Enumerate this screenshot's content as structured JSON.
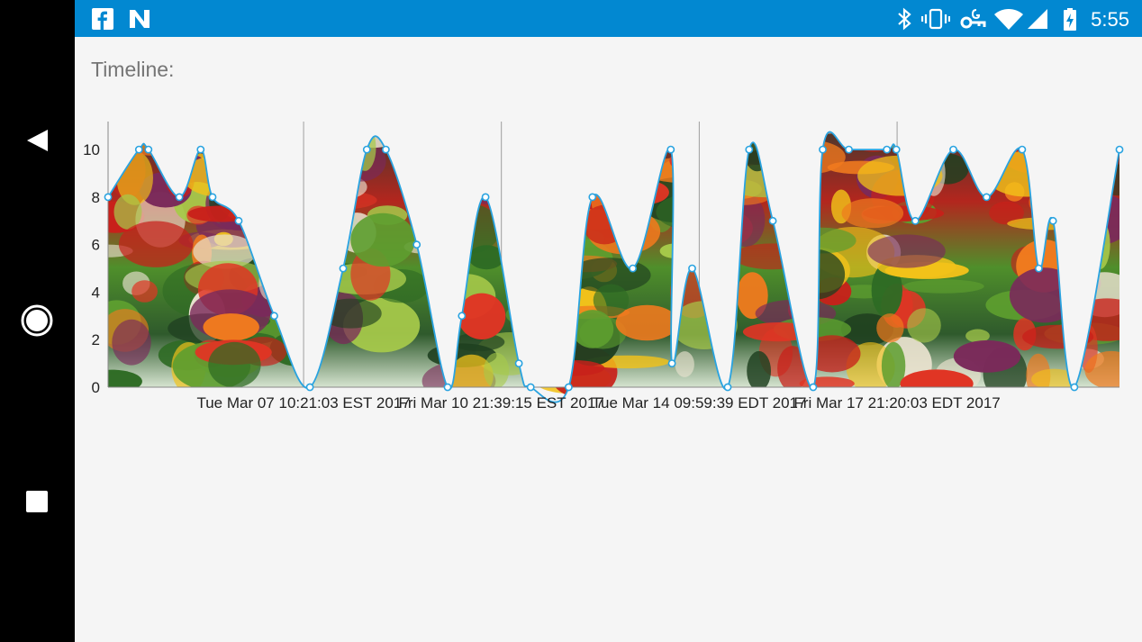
{
  "status_bar": {
    "time": "5:55",
    "left_icons": [
      "facebook-icon",
      "news-icon"
    ],
    "right_icons": [
      "bluetooth-icon",
      "vibrate-icon",
      "vpn-key-icon",
      "wifi-icon",
      "cell-signal-icon",
      "battery-charging-icon"
    ]
  },
  "nav_bar": {
    "buttons": [
      "back",
      "home",
      "recents"
    ]
  },
  "main": {
    "timeline_label": "Timeline:"
  },
  "colors": {
    "status_bar": "#0288d1",
    "nav_bar": "#000000",
    "line": "#29a3e0",
    "background": "#f5f5f5"
  },
  "chart_data": {
    "type": "area",
    "fill": "vegetables photo",
    "ylim": [
      0,
      11
    ],
    "yticks": [
      "0",
      "2",
      "4",
      "6",
      "8",
      "10"
    ],
    "xlim": [
      "2017-03-04T00:00:00-05:00",
      "2017-03-20T00:00:00-04:00"
    ],
    "xticks": [
      {
        "label": "Tue Mar 07 10:21:03 EST 2017",
        "time": "2017-03-07T10:21:03-05:00"
      },
      {
        "label": "Fri Mar 10 21:39:15 EST 2017",
        "time": "2017-03-10T21:39:15-05:00"
      },
      {
        "label": "Tue Mar 14 09:59:39 EDT 2017",
        "time": "2017-03-14T09:59:39-04:00"
      },
      {
        "label": "Fri Mar 17 21:20:03 EDT 2017",
        "time": "2017-03-17T21:20:03-04:00"
      }
    ],
    "grid": "vertical-at-ticks",
    "points": [
      {
        "time": "2017-03-04T00:00:00-05:00",
        "y": 8
      },
      {
        "time": "2017-03-04T13:00:00-05:00",
        "y": 10
      },
      {
        "time": "2017-03-04T17:00:00-05:00",
        "y": 10
      },
      {
        "time": "2017-03-05T06:00:00-05:00",
        "y": 8
      },
      {
        "time": "2017-03-05T15:00:00-05:00",
        "y": 10
      },
      {
        "time": "2017-03-05T20:00:00-05:00",
        "y": 8
      },
      {
        "time": "2017-03-06T07:00:00-05:00",
        "y": 7
      },
      {
        "time": "2017-03-06T22:00:00-05:00",
        "y": 3
      },
      {
        "time": "2017-03-07T13:00:00-05:00",
        "y": 0
      },
      {
        "time": "2017-03-08T03:00:00-05:00",
        "y": 5
      },
      {
        "time": "2017-03-08T13:00:00-05:00",
        "y": 10
      },
      {
        "time": "2017-03-08T21:00:00-05:00",
        "y": 10
      },
      {
        "time": "2017-03-09T10:00:00-05:00",
        "y": 6
      },
      {
        "time": "2017-03-09T23:00:00-05:00",
        "y": 0
      },
      {
        "time": "2017-03-10T05:00:00-05:00",
        "y": 3
      },
      {
        "time": "2017-03-10T15:00:00-05:00",
        "y": 8
      },
      {
        "time": "2017-03-11T05:00:00-05:00",
        "y": 1
      },
      {
        "time": "2017-03-11T10:00:00-05:00",
        "y": 0
      },
      {
        "time": "2017-03-12T02:00:00-05:00",
        "y": 0
      },
      {
        "time": "2017-03-12T13:00:00-04:00",
        "y": 8
      },
      {
        "time": "2017-03-13T06:00:00-04:00",
        "y": 5
      },
      {
        "time": "2017-03-13T22:00:00-04:00",
        "y": 10
      },
      {
        "time": "2017-03-13T22:30:00-04:00",
        "y": 1
      },
      {
        "time": "2017-03-14T07:00:00-04:00",
        "y": 5
      },
      {
        "time": "2017-03-14T22:00:00-04:00",
        "y": 0
      },
      {
        "time": "2017-03-15T07:00:00-04:00",
        "y": 10
      },
      {
        "time": "2017-03-15T17:00:00-04:00",
        "y": 7
      },
      {
        "time": "2017-03-16T10:00:00-04:00",
        "y": 0
      },
      {
        "time": "2017-03-16T14:00:00-04:00",
        "y": 10
      },
      {
        "time": "2017-03-17T01:00:00-04:00",
        "y": 10
      },
      {
        "time": "2017-03-17T17:00:00-04:00",
        "y": 10
      },
      {
        "time": "2017-03-17T21:00:00-04:00",
        "y": 10
      },
      {
        "time": "2017-03-18T05:00:00-04:00",
        "y": 7
      },
      {
        "time": "2017-03-18T21:00:00-04:00",
        "y": 10
      },
      {
        "time": "2017-03-19T11:00:00-04:00",
        "y": 8
      },
      {
        "time": "2017-03-20T02:00:00-04:00",
        "y": 10
      },
      {
        "time": "2017-03-20T09:00:00-04:00",
        "y": 5
      },
      {
        "time": "2017-03-20T15:00:00-04:00",
        "y": 7
      },
      {
        "time": "2017-03-21T00:00:00-04:00",
        "y": 0
      },
      {
        "time": "2017-03-21T19:00:00-04:00",
        "y": 10
      }
    ]
  }
}
